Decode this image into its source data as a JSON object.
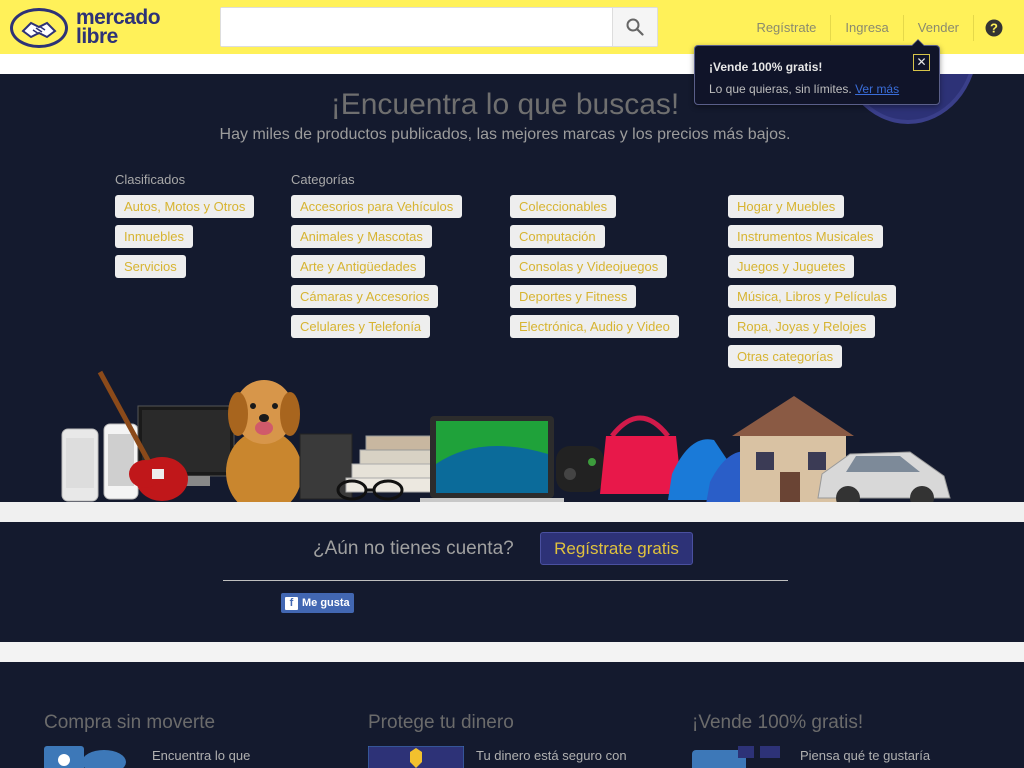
{
  "header": {
    "logo_line1": "mercado",
    "logo_line2": "libre",
    "search_placeholder": "",
    "nav": [
      "Regístrate",
      "Ingresa",
      "Vender"
    ]
  },
  "tooltip": {
    "title": "¡Vende 100% gratis!",
    "body": "Lo que quieras, sin límites.",
    "link": "Ver más"
  },
  "hero": {
    "title": "¡Encuentra lo que buscas!",
    "subtitle": "Hay miles de productos publicados, las mejores marcas y los precios más bajos.",
    "clasificados_label": "Clasificados",
    "categorias_label": "Categorías",
    "clasificados": [
      "Autos, Motos y Otros",
      "Inmuebles",
      "Servicios"
    ],
    "categorias_col1": [
      "Accesorios para Vehículos",
      "Animales y Mascotas",
      "Arte y Antigüedades",
      "Cámaras y Accesorios",
      "Celulares y Telefonía"
    ],
    "categorias_col2": [
      "Coleccionables",
      "Computación",
      "Consolas y Videojuegos",
      "Deportes y Fitness",
      "Electrónica, Audio y Video"
    ],
    "categorias_col3": [
      "Hogar y Muebles",
      "Instrumentos Musicales",
      "Juegos y Juguetes",
      "Música, Libros y Películas",
      "Ropa, Joyas y Relojes",
      "Otras categorías"
    ]
  },
  "register": {
    "question": "¿Aún no tienes cuenta?",
    "button": "Regístrate gratis",
    "like": "Me gusta"
  },
  "features": [
    {
      "title": "Compra sin moverte",
      "text": "Encuentra lo que"
    },
    {
      "title": "Protege tu dinero",
      "text": "Tu dinero está seguro con"
    },
    {
      "title": "¡Vende 100% gratis!",
      "text": "Piensa qué te gustaría"
    }
  ],
  "colors": {
    "brand_yellow": "#fff159",
    "brand_blue": "#2d3277",
    "hero_bg": "#141a2e",
    "chip_text": "#d7b431"
  }
}
